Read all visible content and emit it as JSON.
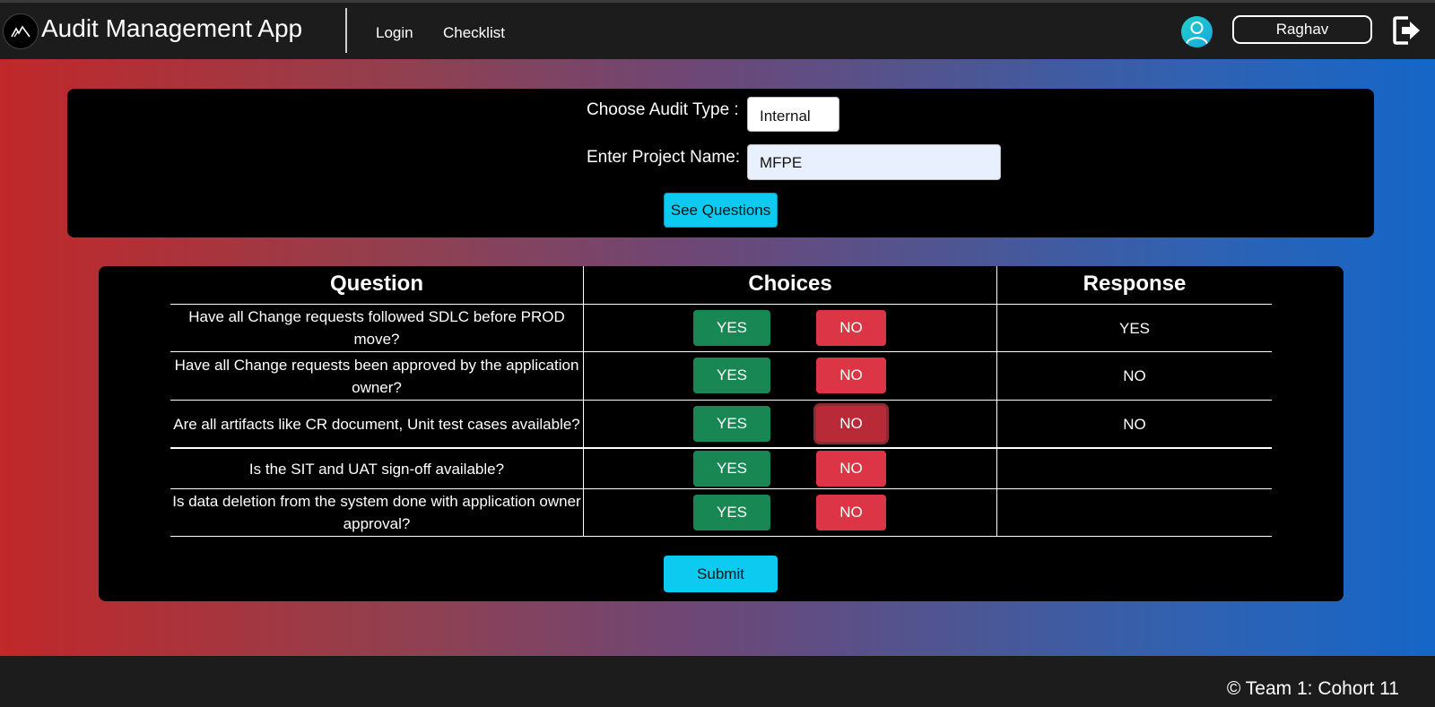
{
  "navbar": {
    "brand": "Audit Management App",
    "links": [
      "Login",
      "Checklist"
    ],
    "user_name": "Raghav"
  },
  "form": {
    "audit_type_label": "Choose Audit Type :",
    "audit_type_value": "Internal",
    "project_label": "Enter Project Name:",
    "project_value": "MFPE",
    "see_questions_label": "See Questions"
  },
  "table": {
    "headers": [
      "Question",
      "Choices",
      "Response"
    ],
    "rows": [
      {
        "question": "Have all Change requests followed SDLC before PROD move?",
        "yes": "YES",
        "no": "NO",
        "response": "YES"
      },
      {
        "question": "Have all Change requests been approved by the application owner?",
        "yes": "YES",
        "no": "NO",
        "response": "NO"
      },
      {
        "question": "Are all artifacts like CR document, Unit test cases available?",
        "yes": "YES",
        "no": "NO",
        "response": "NO"
      },
      {
        "question": "Is the SIT and UAT sign-off available?",
        "yes": "YES",
        "no": "NO",
        "response": ""
      },
      {
        "question": "Is data deletion from the system done with application owner approval?",
        "yes": "YES",
        "no": "NO",
        "response": ""
      }
    ],
    "submit_label": "Submit"
  },
  "footer": {
    "copyright": "© Team 1: Cohort 11"
  },
  "colors": {
    "yes": "#198754",
    "no": "#dc3545",
    "accent": "#0dcaf0",
    "nav_bg": "#1c1c1c"
  },
  "icons": [
    "mountain-logo-icon",
    "user-avatar-icon",
    "logout-icon"
  ]
}
